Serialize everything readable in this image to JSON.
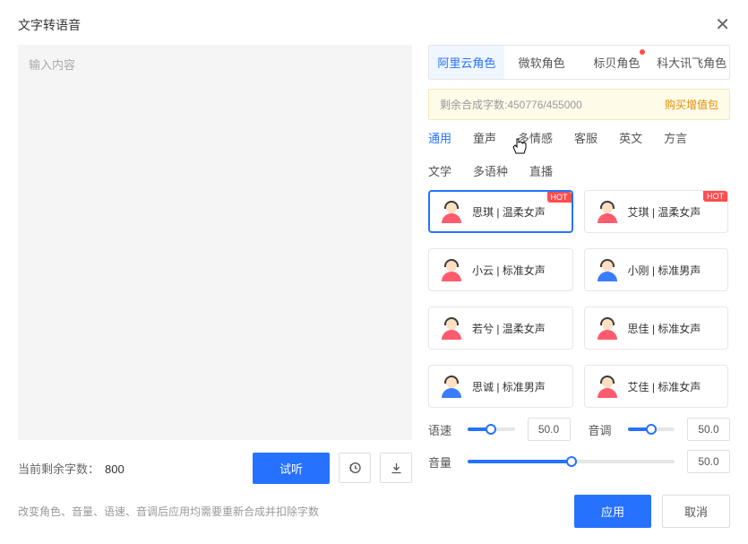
{
  "title": "文字转语音",
  "textarea_placeholder": "输入内容",
  "remain_label": "当前剩余字数：",
  "remain_value": "800",
  "preview_btn": "试听",
  "provider_tabs": [
    "阿里云角色",
    "微软角色",
    "标贝角色",
    "科大讯飞角色"
  ],
  "provider_active": 0,
  "provider_badge_index": 2,
  "quota_text": "剩余合成字数:450776/455000",
  "quota_buy": "购买增值包",
  "cat_tabs": [
    "通用",
    "童声",
    "多情感",
    "客服",
    "英文",
    "方言",
    "文学",
    "多语种",
    "直播"
  ],
  "cat_active": 0,
  "voices": [
    {
      "name": "思琪 | 温柔女声",
      "gender": "f",
      "hot": true,
      "selected": true
    },
    {
      "name": "艾琪 | 温柔女声",
      "gender": "f",
      "hot": true
    },
    {
      "name": "小云 | 标准女声",
      "gender": "f"
    },
    {
      "name": "小刚 | 标准男声",
      "gender": "m"
    },
    {
      "name": "若兮 | 温柔女声",
      "gender": "f"
    },
    {
      "name": "思佳 | 标准女声",
      "gender": "f"
    },
    {
      "name": "思诚 | 标准男声",
      "gender": "m"
    },
    {
      "name": "艾佳 | 标准女声",
      "gender": "f"
    }
  ],
  "hot_label": "HOT",
  "sliders": {
    "speed_label": "语速",
    "speed_val": "50.0",
    "pitch_label": "音调",
    "pitch_val": "50.0",
    "volume_label": "音量",
    "volume_val": "50.0"
  },
  "hint": "改变角色、音量、语速、音调后应用均需要重新合成并扣除字数",
  "apply_btn": "应用",
  "cancel_btn": "取消"
}
